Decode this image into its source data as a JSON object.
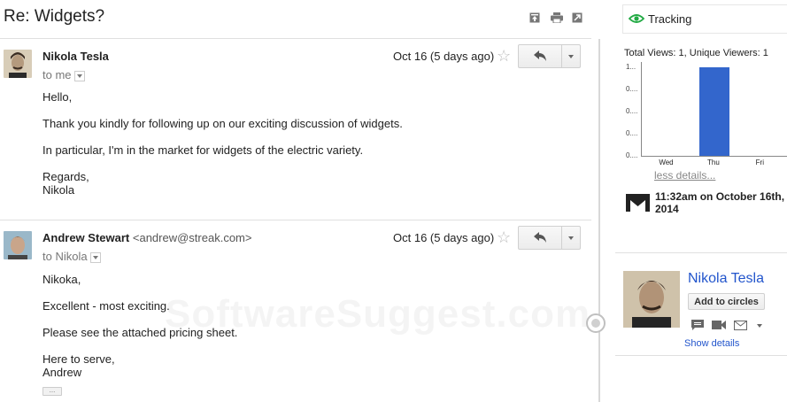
{
  "thread": {
    "subject": "Re: Widgets?",
    "toolbar": {
      "icons": [
        "archive-up-icon",
        "print-icon",
        "popout-icon"
      ]
    }
  },
  "messages": [
    {
      "sender": "Nikola Tesla",
      "email": "",
      "to": "to me",
      "date": "Oct 16 (5 days ago)",
      "body": [
        "Hello,",
        "Thank you kindly for following up on our exciting discussion of widgets.",
        "In particular, I'm in the market for widgets of the electric variety.",
        "Regards,",
        "Nikola"
      ]
    },
    {
      "sender": "Andrew Stewart",
      "email": "<andrew@streak.com>",
      "to": "to Nikola",
      "date": "Oct 16 (5 days ago)",
      "body": [
        "Nikoka,",
        "Excellent - most exciting.",
        "Please see the attached pricing sheet.",
        "Here to serve,",
        "Andrew"
      ],
      "ellipsis": "..."
    }
  ],
  "tracking": {
    "tab_label": "Tracking",
    "less_details": "less details...",
    "timestamp": "11:32am on October 16th, 2014",
    "colors": {
      "eye": "#22aa44",
      "bar": "#3366cc"
    }
  },
  "chart_data": {
    "type": "bar",
    "title": "Total Views: 1, Unique Viewers: 1",
    "categories": [
      "Wed",
      "Thu",
      "Fri"
    ],
    "values": [
      0,
      1,
      0
    ],
    "y_tick_labels": [
      "1...",
      "0....",
      "0....",
      "0....",
      "0...."
    ],
    "ylim": [
      0,
      1
    ],
    "grid": false
  },
  "contact": {
    "name": "Nikola Tesla",
    "add_button": "Add to circles",
    "show_details": "Show details"
  },
  "watermark": "SoftwareSuggest.com"
}
